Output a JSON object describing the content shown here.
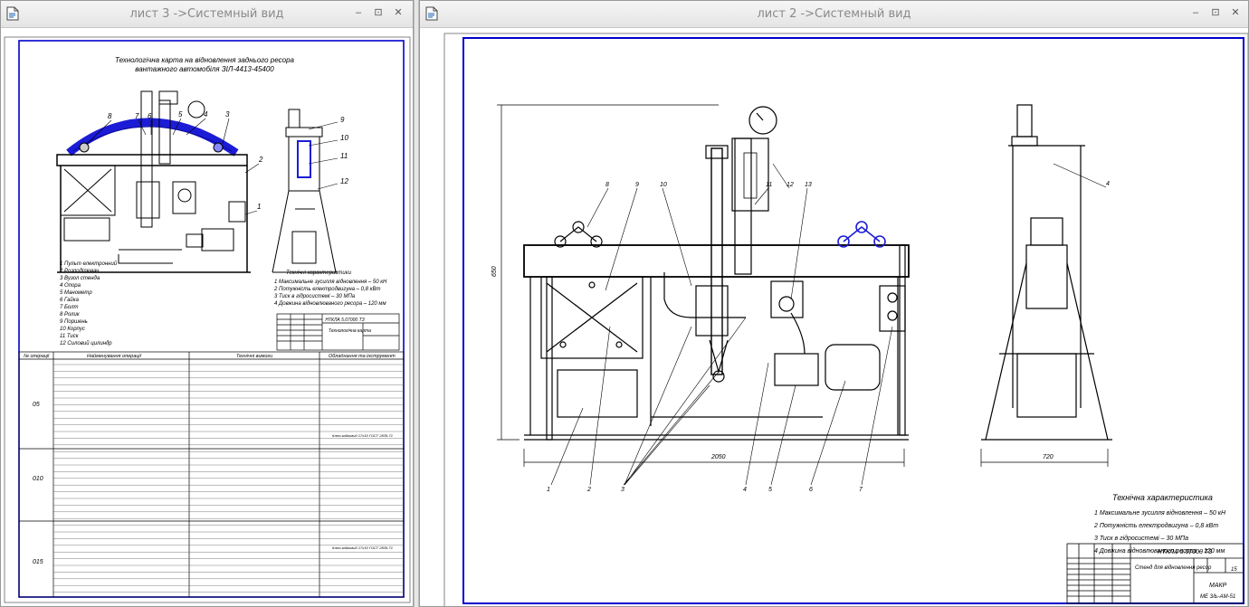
{
  "windows": {
    "left": {
      "title": "лист 3 ->Системный вид",
      "buttons": [
        "–",
        "⊡",
        "✕"
      ]
    },
    "right": {
      "title": "лист 2 ->Системный вид",
      "buttons": [
        "–",
        "⊡",
        "✕"
      ]
    }
  },
  "sheet3": {
    "heading_line1": "Технологічна карта на відновлення заднього ресора",
    "heading_line2": "вантажного автомобіля ЗІЛ-4413-45400",
    "callouts": [
      "8",
      "7",
      "6",
      "5",
      "4",
      "3",
      "2",
      "1",
      "9",
      "10",
      "11",
      "12"
    ],
    "legend": [
      "1 Пульт електронний",
      "2 Розподілювач",
      "3 Вузол стенда",
      "4 Опора",
      "5 Манометр",
      "6 Гайка",
      "7 Болт",
      "8 Ролик",
      "9 Поршень",
      "10 Корпус",
      "11 Тиск",
      "12 Силовий цилиндр"
    ],
    "spec_title": "Технічні характеристики",
    "specs": [
      "1 Максимальне зусилля відновлення – 50 кН",
      "2 Потужність електродвигуна – 0,8 кВт",
      "3 Тиск в гідросистемі – 30 МПа",
      "4 Довжина відновлюваного ресора – 120 мм"
    ],
    "stamp_code": "НТКЛА 5.07000 ТЗ",
    "stamp_title": "Технологічна карта",
    "table_headers": [
      "№ операції",
      "Найменування операції",
      "Технічні вимоги",
      "Обладнання та інструмент"
    ],
    "operations": [
      "05",
      "010",
      "015"
    ],
    "op_equipment": "Ключ гайковий 17x19 ГОСТ 2839-71"
  },
  "sheet2": {
    "dim_height": "650",
    "dim_width_left": "2050",
    "dim_width_right": "720",
    "callouts_top": [
      "8",
      "9",
      "10",
      "11",
      "12",
      "13",
      "4"
    ],
    "callouts_bottom": [
      "1",
      "2",
      "3",
      "4",
      "5",
      "6",
      "7"
    ],
    "spec_title": "Технічна характеристика",
    "specs": [
      "1 Максимальне зусилля відновлення – 50 кН",
      "2 Потужність електродвигуна – 0,8 кВт",
      "3 Тиск в гідросистемі – 30 МПа",
      "4 Довжина відновлюваного ресора – 120 мм"
    ],
    "stamp_code": "НТКЛА 5.07000 ТЗ",
    "stamp_title": "Стенд для відновлення ресор",
    "stamp_org": "МАКР",
    "stamp_group": "МЕ 3/Ь-АМ-51",
    "stamp_sheet": "15"
  },
  "colors": {
    "frame": "#0000cc",
    "drawing": "#000000",
    "highlight": "#1c1cd6"
  }
}
